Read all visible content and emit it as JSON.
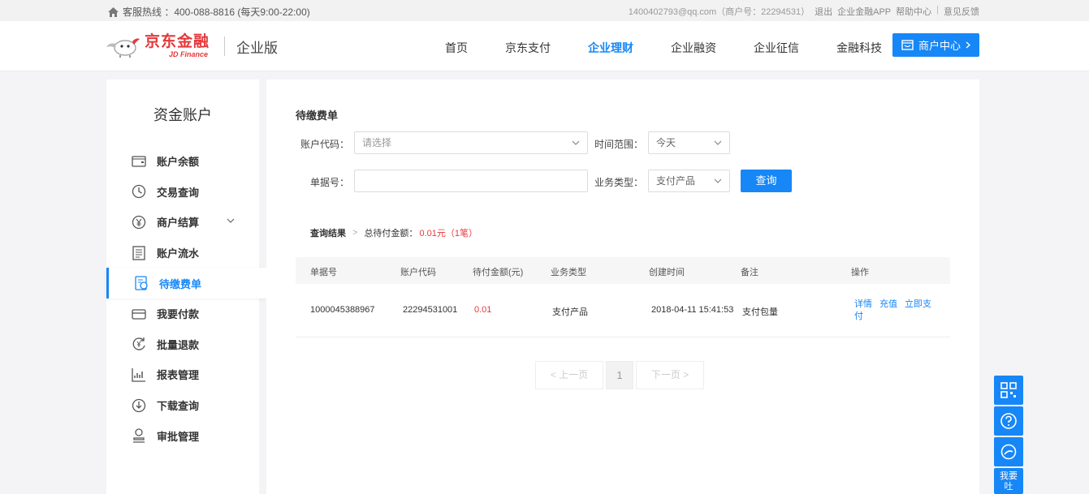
{
  "topbar": {
    "hotline": "客服热线 ：400-088-8816 (每天9:00-22:00)",
    "account": "1400402793@qq.com（商户号：22294531）",
    "logout": "退出",
    "app": "企业金融APP",
    "help": "帮助中心",
    "feedback": "意见反馈"
  },
  "header": {
    "brand_cn": "京东金融",
    "brand_en": "JD Finance",
    "edition": "企业版",
    "nav": [
      "首页",
      "京东支付",
      "企业理财",
      "企业融资",
      "企业征信",
      "金融科技"
    ],
    "active_nav": "企业理财",
    "merchant_center": "商户中心"
  },
  "sidebar": {
    "title": "资金账户",
    "items": [
      {
        "label": "账户余额",
        "icon": "wallet-icon"
      },
      {
        "label": "交易查询",
        "icon": "clock-icon"
      },
      {
        "label": "商户结算",
        "icon": "yen-icon"
      },
      {
        "label": "账户流水",
        "icon": "ledger-icon"
      },
      {
        "label": "待缴费单",
        "icon": "bill-icon"
      },
      {
        "label": "我要付款",
        "icon": "card-icon"
      },
      {
        "label": "批量退款",
        "icon": "refund-icon"
      },
      {
        "label": "报表管理",
        "icon": "chart-icon"
      },
      {
        "label": "下载查询",
        "icon": "download-icon"
      },
      {
        "label": "审批管理",
        "icon": "user-icon"
      }
    ],
    "active": "待缴费单"
  },
  "main": {
    "section_title": "待缴费单",
    "form": {
      "account_code_label": "账户代码：",
      "account_code_placeholder": "请选择",
      "time_range_label": "时间范围：",
      "time_range_value": "今天",
      "bill_no_label": "单据号：",
      "bill_no_value": "",
      "biz_type_label": "业务类型：",
      "biz_type_value": "支付产品",
      "query_button": "查询"
    },
    "result": {
      "label": "查询结果",
      "total_label": "总待付金额：",
      "total_value": "0.01元（1笔）"
    },
    "table": {
      "headers": [
        "单据号",
        "账户代码",
        "待付金额(元)",
        "业务类型",
        "创建时间",
        "备注",
        "操作"
      ],
      "rows": [
        {
          "bill_no": "1000045388967",
          "account_code": "22294531001",
          "amount": "0.01",
          "biz_type": "支付产品",
          "created": "2018-04-11 15:41:53",
          "remark": "支付包量",
          "ops": [
            "详情",
            "充值",
            "立即支付"
          ]
        }
      ]
    },
    "pager": {
      "prev": "< 上一页",
      "current": "1",
      "next": "下一页 >"
    }
  },
  "float_tools": {
    "feedback_label": "我要吐"
  },
  "colors": {
    "accent": "#1787f7",
    "brand_red": "#e4393c"
  }
}
